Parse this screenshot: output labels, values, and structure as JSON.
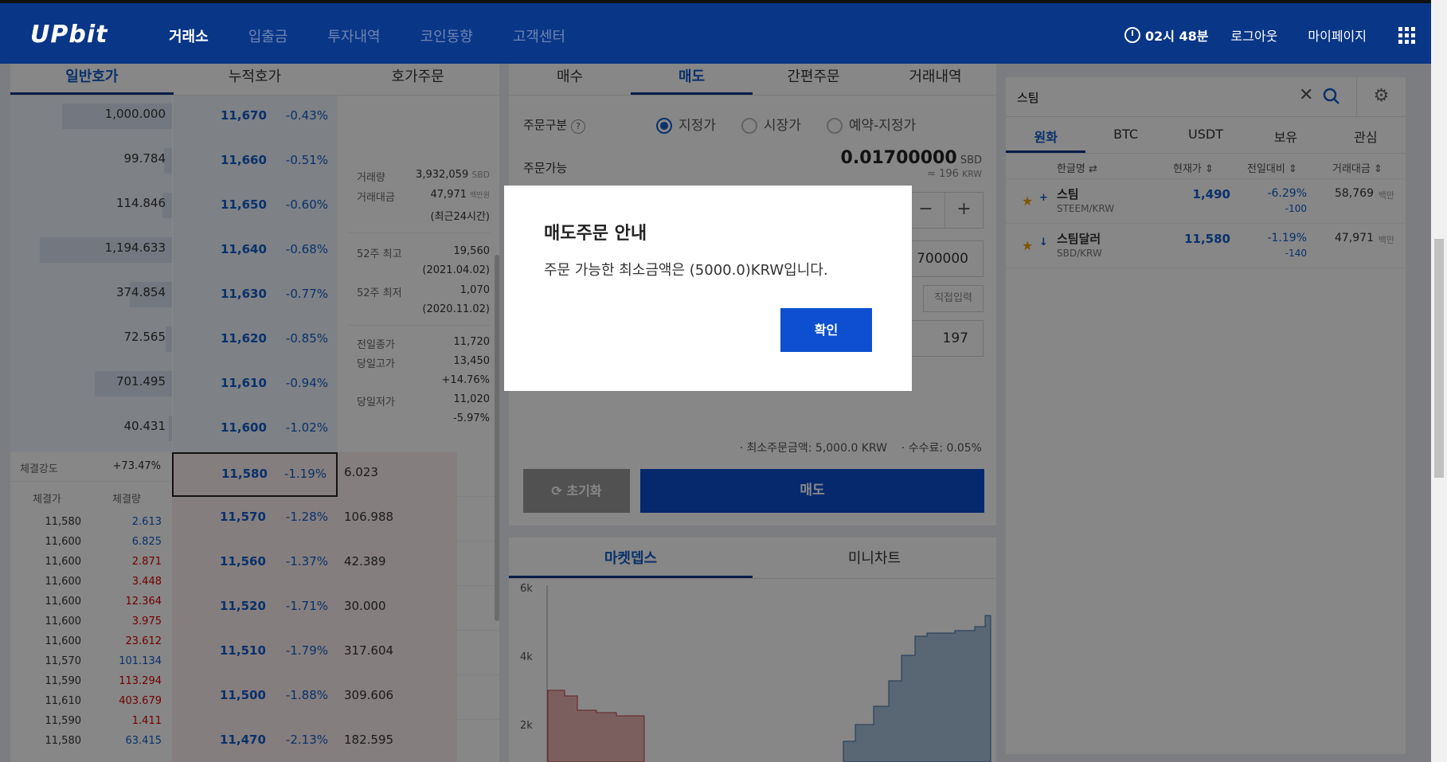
{
  "header": {
    "logo": "UPbit",
    "nav": [
      "거래소",
      "입출금",
      "투자내역",
      "코인동향",
      "고객센터"
    ],
    "time": "02시 48분",
    "logout": "로그아웃",
    "mypage": "마이페이지"
  },
  "orderbook": {
    "tabs": [
      "일반호가",
      "누적호가",
      "호가주문"
    ],
    "asks": [
      {
        "qty": "1,000.000",
        "price": "11,670",
        "rate": "-0.43%",
        "fill": 0.68
      },
      {
        "qty": "99.784",
        "price": "11,660",
        "rate": "-0.51%",
        "fill": 0.05
      },
      {
        "qty": "114.846",
        "price": "11,650",
        "rate": "-0.60%",
        "fill": 0.06
      },
      {
        "qty": "1,194.633",
        "price": "11,640",
        "rate": "-0.68%",
        "fill": 0.82
      },
      {
        "qty": "374.854",
        "price": "11,630",
        "rate": "-0.77%",
        "fill": 0.26
      },
      {
        "qty": "72.565",
        "price": "11,620",
        "rate": "-0.85%",
        "fill": 0.04
      },
      {
        "qty": "701.495",
        "price": "11,610",
        "rate": "-0.94%",
        "fill": 0.48
      },
      {
        "qty": "40.431",
        "price": "11,600",
        "rate": "-1.02%",
        "fill": 0.02
      }
    ],
    "bids": [
      {
        "price": "11,580",
        "rate": "-1.19%",
        "qty": "6.023"
      },
      {
        "price": "11,570",
        "rate": "-1.28%",
        "qty": "106.988"
      },
      {
        "price": "11,560",
        "rate": "-1.37%",
        "qty": "42.389"
      },
      {
        "price": "11,520",
        "rate": "-1.71%",
        "qty": "30.000"
      },
      {
        "price": "11,510",
        "rate": "-1.79%",
        "qty": "317.604"
      },
      {
        "price": "11,500",
        "rate": "-1.88%",
        "qty": "309.606"
      },
      {
        "price": "11,470",
        "rate": "-2.13%",
        "qty": "182.595"
      }
    ],
    "info": {
      "volume_label": "거래량",
      "volume": "3,932,059",
      "volume_unit": "SBD",
      "amount_label": "거래대금",
      "amount": "47,971",
      "amount_unit": "백만원",
      "amount_note": "(최근24시간)",
      "high52_label": "52주 최고",
      "high52": "19,560",
      "high52_date": "(2021.04.02)",
      "low52_label": "52주 최저",
      "low52": "1,070",
      "low52_date": "(2020.11.02)",
      "prev_label": "전일종가",
      "prev": "11,720",
      "dayhigh_label": "당일고가",
      "dayhigh": "13,450",
      "dayhigh_rate": "+14.76%",
      "daylow_label": "당일저가",
      "daylow": "11,020",
      "daylow_rate": "-5.97%"
    },
    "strength_label": "체결강도",
    "strength": "+73.47%",
    "trade_price_label": "체결가",
    "trade_qty_label": "체결량",
    "trades": [
      {
        "p": "11,580",
        "q": "2.613",
        "c": "blue"
      },
      {
        "p": "11,600",
        "q": "6.825",
        "c": "blue"
      },
      {
        "p": "11,600",
        "q": "2.871",
        "c": "red"
      },
      {
        "p": "11,600",
        "q": "3.448",
        "c": "red"
      },
      {
        "p": "11,600",
        "q": "12.364",
        "c": "red"
      },
      {
        "p": "11,600",
        "q": "3.975",
        "c": "red"
      },
      {
        "p": "11,600",
        "q": "23.612",
        "c": "red"
      },
      {
        "p": "11,570",
        "q": "101.134",
        "c": "blue"
      },
      {
        "p": "11,590",
        "q": "113.294",
        "c": "red"
      },
      {
        "p": "11,610",
        "q": "403.679",
        "c": "red"
      },
      {
        "p": "11,590",
        "q": "1.411",
        "c": "red"
      },
      {
        "p": "11,580",
        "q": "63.415",
        "c": "blue"
      }
    ]
  },
  "order": {
    "tabs": [
      "매수",
      "매도",
      "간편주문",
      "거래내역"
    ],
    "type_label": "주문구분",
    "types": [
      "지정가",
      "시장가",
      "예약-지정가"
    ],
    "available_label": "주문가능",
    "available": "0.01700000",
    "available_unit": "SBD",
    "available_krw": "≈ 196",
    "available_krw_unit": "KRW",
    "price_value": "700000",
    "direct_input": "직접입력",
    "total_value": "197",
    "min_order": "최소주문금액: 5,000.0 KRW",
    "fee": "수수료: 0.05%",
    "reset": "초기화",
    "sell": "매도"
  },
  "depth": {
    "tabs": [
      "마켓뎁스",
      "미니차트"
    ],
    "y_ticks": [
      "6k",
      "4k",
      "2k"
    ]
  },
  "list": {
    "search_value": "스팀",
    "tabs": [
      "원화",
      "BTC",
      "USDT",
      "보유",
      "관심"
    ],
    "columns": [
      "한글명",
      "현재가",
      "전일대비",
      "거래대금"
    ],
    "rows": [
      {
        "name": "스팀",
        "code": "STEEM/KRW",
        "price": "1,490",
        "rate": "-6.29%",
        "diff": "-100",
        "amount": "58,769",
        "unit": "백만"
      },
      {
        "name": "스팀달러",
        "code": "SBD/KRW",
        "price": "11,580",
        "rate": "-1.19%",
        "diff": "-140",
        "amount": "47,971",
        "unit": "백만"
      }
    ]
  },
  "modal": {
    "title": "매도주문 안내",
    "message": "주문 가능한 최소금액은 (5000.0)KRW입니다.",
    "confirm": "확인"
  }
}
